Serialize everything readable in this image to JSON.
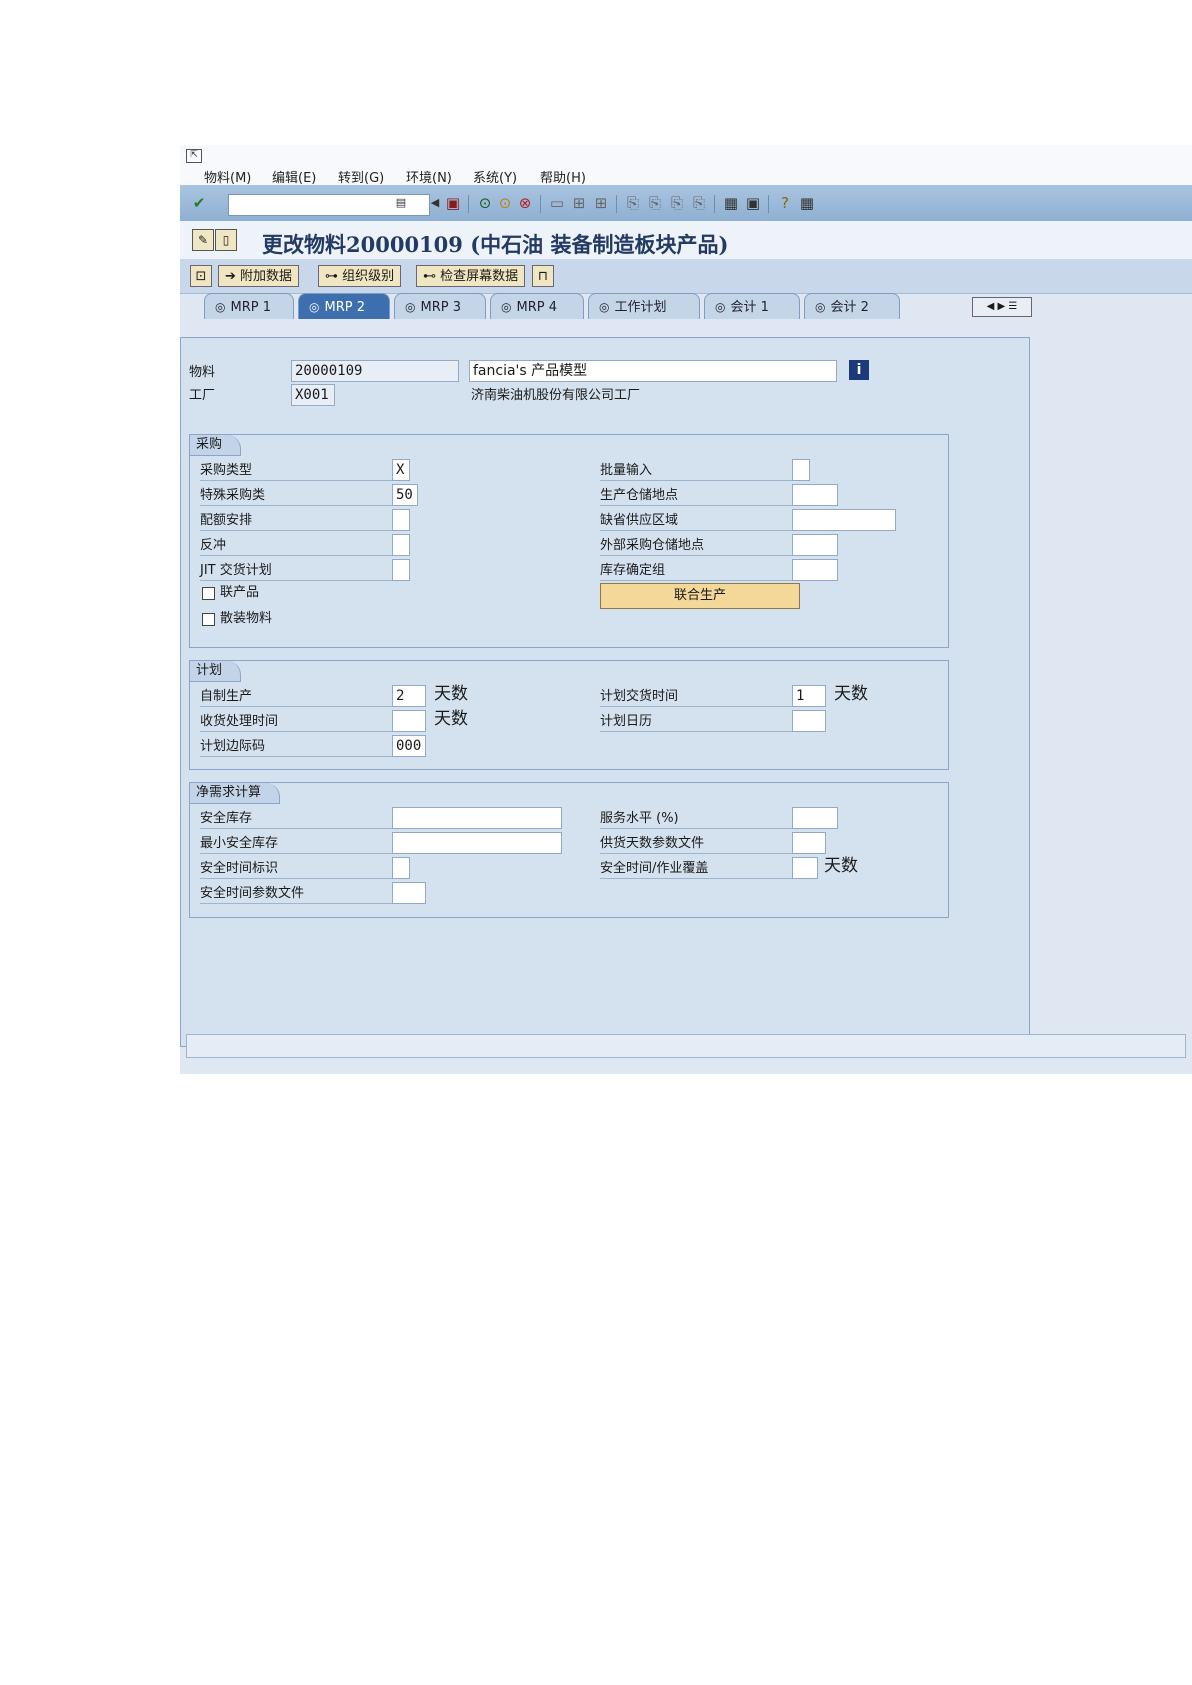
{
  "menu": [
    "物料(M)",
    "编辑(E)",
    "转到(G)",
    "环境(N)",
    "系统(Y)",
    "帮助(H)"
  ],
  "title": "更改物料20000109 (中石油 装备制造板块产品)",
  "app_toolbar": {
    "additional_data": "附加数据",
    "org_levels": "组织级别",
    "check_screen": "检查屏幕数据"
  },
  "tabs": [
    "MRP 1",
    "MRP 2",
    "MRP 3",
    "MRP 4",
    "工作计划",
    "会计 1",
    "会计 2"
  ],
  "active_tab": "MRP 2",
  "header": {
    "material_label": "物料",
    "material_value": "20000109",
    "material_desc": "fancia's 产品模型",
    "plant_label": "工厂",
    "plant_value": "X001",
    "plant_desc": "济南柴油机股份有限公司工厂"
  },
  "procurement": {
    "title": "采购",
    "type_label": "采购类型",
    "type_value": "X",
    "special_label": "特殊采购类",
    "special_value": "50",
    "quota_label": "配额安排",
    "backflush_label": "反冲",
    "jit_label": "JIT 交货计划",
    "coproduct_label": "联产品",
    "bulk_label": "散装物料",
    "batch_entry_label": "批量输入",
    "prod_stor_label": "生产仓储地点",
    "default_supply_label": "缺省供应区域",
    "ext_stor_label": "外部采购仓储地点",
    "stock_det_label": "库存确定组",
    "joint_prod_button": "联合生产"
  },
  "planning": {
    "title": "计划",
    "inhouse_label": "自制生产",
    "inhouse_value": "2",
    "inhouse_unit": "天数",
    "gr_label": "收货处理时间",
    "gr_unit": "天数",
    "margin_label": "计划边际码",
    "margin_value": "000",
    "delivery_label": "计划交货时间",
    "delivery_value": "1",
    "delivery_unit": "天数",
    "calendar_label": "计划日历"
  },
  "net_req": {
    "title": "净需求计算",
    "safety_stock_label": "安全库存",
    "min_safety_label": "最小安全库存",
    "safety_time_ind_label": "安全时间标识",
    "safety_time_profile_label": "安全时间参数文件",
    "service_level_label": "服务水平 (%)",
    "coverage_profile_label": "供货天数参数文件",
    "safety_time_label": "安全时间/作业覆盖",
    "safety_time_unit": "天数"
  }
}
